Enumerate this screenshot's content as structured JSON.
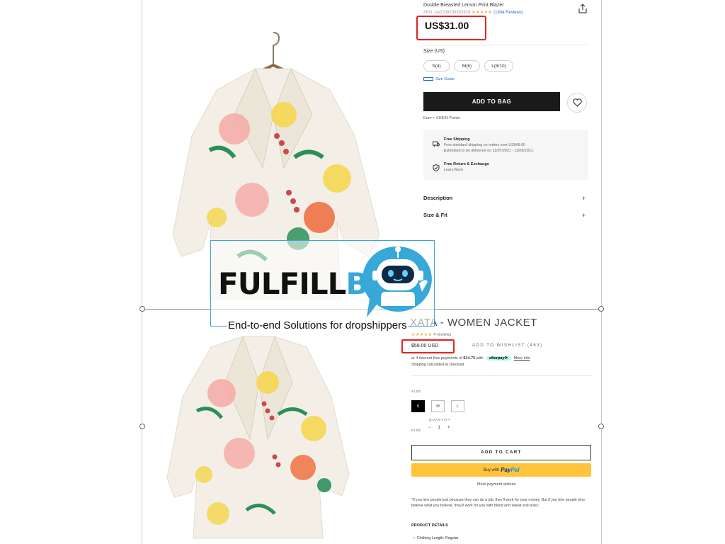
{
  "top_listing": {
    "title": "Double Breasted Lemon Print Blazer",
    "sku": "SKU: sw2108230302918",
    "stars": "★★★★★",
    "reviews": "(1804 Reviews)",
    "price": "US$31.00",
    "size_label": "Size (US)",
    "sizes": [
      "S(4)",
      "M(6)",
      "L(8/10)"
    ],
    "size_guide": "Size Guide",
    "add_to_bag": "ADD TO BAG",
    "points_prefix": "Earn",
    "points_suffix": "SHEIN Points",
    "free_shipping_title": "Free Shipping",
    "free_shipping_line1": "Free standard shipping on orders over US$49.00",
    "free_shipping_line2": "Estimated to be delivered on 11/07/2021 - 11/09/2021.",
    "free_return_title": "Free Return & Exchange",
    "free_return_line": "Learn More",
    "description_label": "Description",
    "size_fit_label": "Size & Fit",
    "plus": "+"
  },
  "bottom_listing": {
    "title": "XATA - WOMEN JACKET",
    "stars": "★★★★★",
    "reviews": "4 reviews",
    "price": "$59.00 USD",
    "wishlist": "ADD TO WISHLIST (463)",
    "installment_prefix": "or 4 interest-free payments of",
    "installment_amount": "$14.75",
    "installment_with": "with",
    "afterpay": "afterpay⟳",
    "more_info": "More info",
    "shipping_note": "Shipping calculated at checkout",
    "size_label": "SIZE",
    "sizes": [
      "S",
      "M",
      "L"
    ],
    "selected_size": "S",
    "quantity_label": "QUANTITY",
    "size_label_2": "SIZE",
    "qty_minus": "−",
    "qty_value": "1",
    "qty_plus": "+",
    "add_to_cart": "ADD TO CART",
    "buy_with": "Buy with",
    "paypal_a": "Pay",
    "paypal_b": "Pal",
    "more_payment": "More payment options",
    "quote": "\"If you hire people just because they can do a job, they'll work for your money. But if you hire people who believe what you believe, they'll work for you with blood and sweat and tears.\"",
    "details_label": "PRODUCT DETAILS",
    "detail_1": "Clothing Length: Regular"
  },
  "overlay": {
    "brand_a": "FULFILL",
    "brand_b": "BOT",
    "tagline": "End-to-end Solutions for dropshippers"
  },
  "colors": {
    "highlight": "#e02424",
    "brand_blue": "#38a8d8",
    "paypal_yellow": "#ffc439",
    "afterpay_mint": "#b2fce4"
  }
}
